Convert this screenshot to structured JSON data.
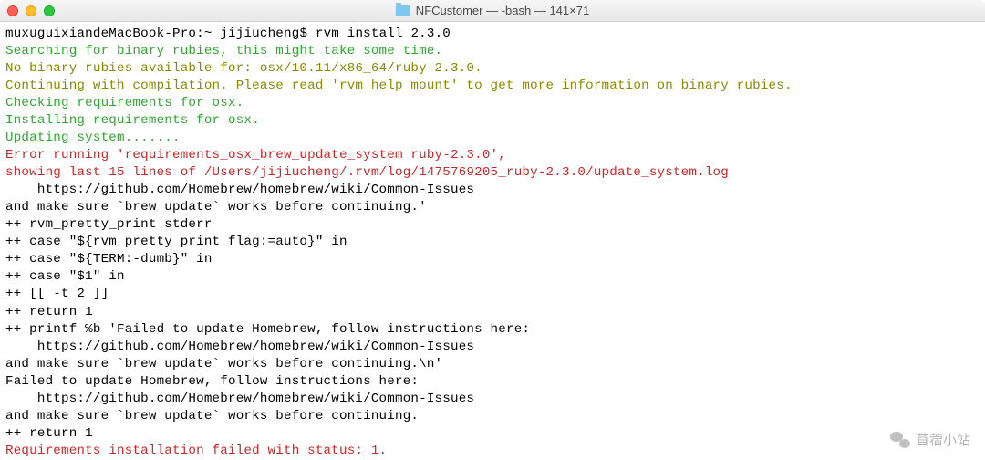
{
  "titlebar": {
    "title": "NFCustomer — -bash — 141×71"
  },
  "prompt": {
    "host": "muxuguixiandeMacBook-Pro",
    "path": "~",
    "user": "jijiucheng",
    "symbol": "$",
    "command": "rvm install 2.3.0"
  },
  "lines": [
    {
      "cls": "green",
      "text": "Searching for binary rubies, this might take some time."
    },
    {
      "cls": "olive",
      "text": "No binary rubies available for: osx/10.11/x86_64/ruby-2.3.0."
    },
    {
      "cls": "olive",
      "text": "Continuing with compilation. Please read 'rvm help mount' to get more information on binary rubies."
    },
    {
      "cls": "green",
      "text": "Checking requirements for osx."
    },
    {
      "cls": "green",
      "text": "Installing requirements for osx."
    },
    {
      "cls": "green",
      "text": "Updating system......."
    },
    {
      "cls": "red",
      "text": "Error running 'requirements_osx_brew_update_system ruby-2.3.0',"
    },
    {
      "cls": "red",
      "text": "showing last 15 lines of /Users/jijiucheng/.rvm/log/1475769205_ruby-2.3.0/update_system.log"
    },
    {
      "cls": "black",
      "text": "    https://github.com/Homebrew/homebrew/wiki/Common-Issues"
    },
    {
      "cls": "black",
      "text": "and make sure `brew update` works before continuing.'"
    },
    {
      "cls": "black",
      "text": "++ rvm_pretty_print stderr"
    },
    {
      "cls": "black",
      "text": "++ case \"${rvm_pretty_print_flag:=auto}\" in"
    },
    {
      "cls": "black",
      "text": "++ case \"${TERM:-dumb}\" in"
    },
    {
      "cls": "black",
      "text": "++ case \"$1\" in"
    },
    {
      "cls": "black",
      "text": "++ [[ -t 2 ]]"
    },
    {
      "cls": "black",
      "text": "++ return 1"
    },
    {
      "cls": "black",
      "text": "++ printf %b 'Failed to update Homebrew, follow instructions here:"
    },
    {
      "cls": "black",
      "text": "    https://github.com/Homebrew/homebrew/wiki/Common-Issues"
    },
    {
      "cls": "black",
      "text": "and make sure `brew update` works before continuing.\\n'"
    },
    {
      "cls": "black",
      "text": "Failed to update Homebrew, follow instructions here:"
    },
    {
      "cls": "black",
      "text": "    https://github.com/Homebrew/homebrew/wiki/Common-Issues"
    },
    {
      "cls": "black",
      "text": "and make sure `brew update` works before continuing."
    },
    {
      "cls": "black",
      "text": "++ return 1"
    },
    {
      "cls": "red",
      "text": "Requirements installation failed with status: 1."
    }
  ],
  "watermark": {
    "text": "苜蓿小站"
  }
}
